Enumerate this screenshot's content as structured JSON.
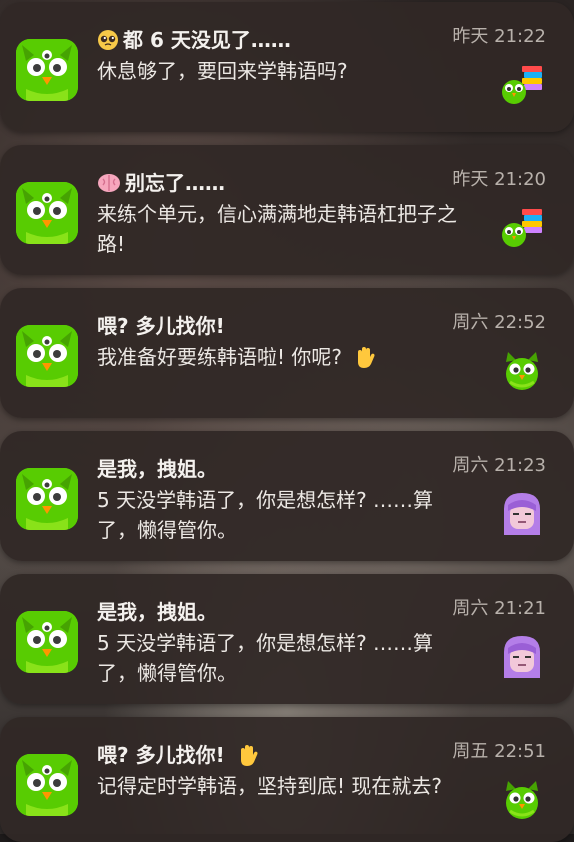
{
  "notifications": [
    {
      "title": "都 6 天没见了……",
      "title_emoji": "pleading-face-icon",
      "body": "休息够了，要回来学韩语吗?",
      "time": "昨天 21:22",
      "thumbnail": "duo-books-icon"
    },
    {
      "title": "别忘了……",
      "title_emoji": "brain-icon",
      "body": "来练个单元，信心满满地走韩语杠把子之路!",
      "time": "昨天 21:20",
      "thumbnail": "duo-books-icon"
    },
    {
      "title": "喂? 多儿找你!",
      "body": "我准备好要练韩语啦! 你呢?",
      "body_emoji": "waving-hand-icon",
      "time": "周六 22:52",
      "thumbnail": "duo-owl-icon"
    },
    {
      "title": "是我，拽姐。",
      "body": "5 天没学韩语了，你是想怎样? ……算了，懒得管你。",
      "time": "周六 21:23",
      "thumbnail": "lily-character-icon"
    },
    {
      "title": "是我，拽姐。",
      "body": "5 天没学韩语了，你是想怎样? ……算了，懒得管你。",
      "time": "周六 21:21",
      "thumbnail": "lily-character-icon"
    },
    {
      "title": "喂? 多儿找你!",
      "title_emoji": "waving-hand-icon",
      "body": "记得定时学韩语，坚持到底! 现在就去?",
      "time": "周五 22:51",
      "thumbnail": "duo-owl-icon"
    }
  ],
  "colors": {
    "icon_green": "#58cc02",
    "lily_purple": "#b47ee8",
    "card_bg": "#302826",
    "time_gray": "#b8b1ab"
  }
}
